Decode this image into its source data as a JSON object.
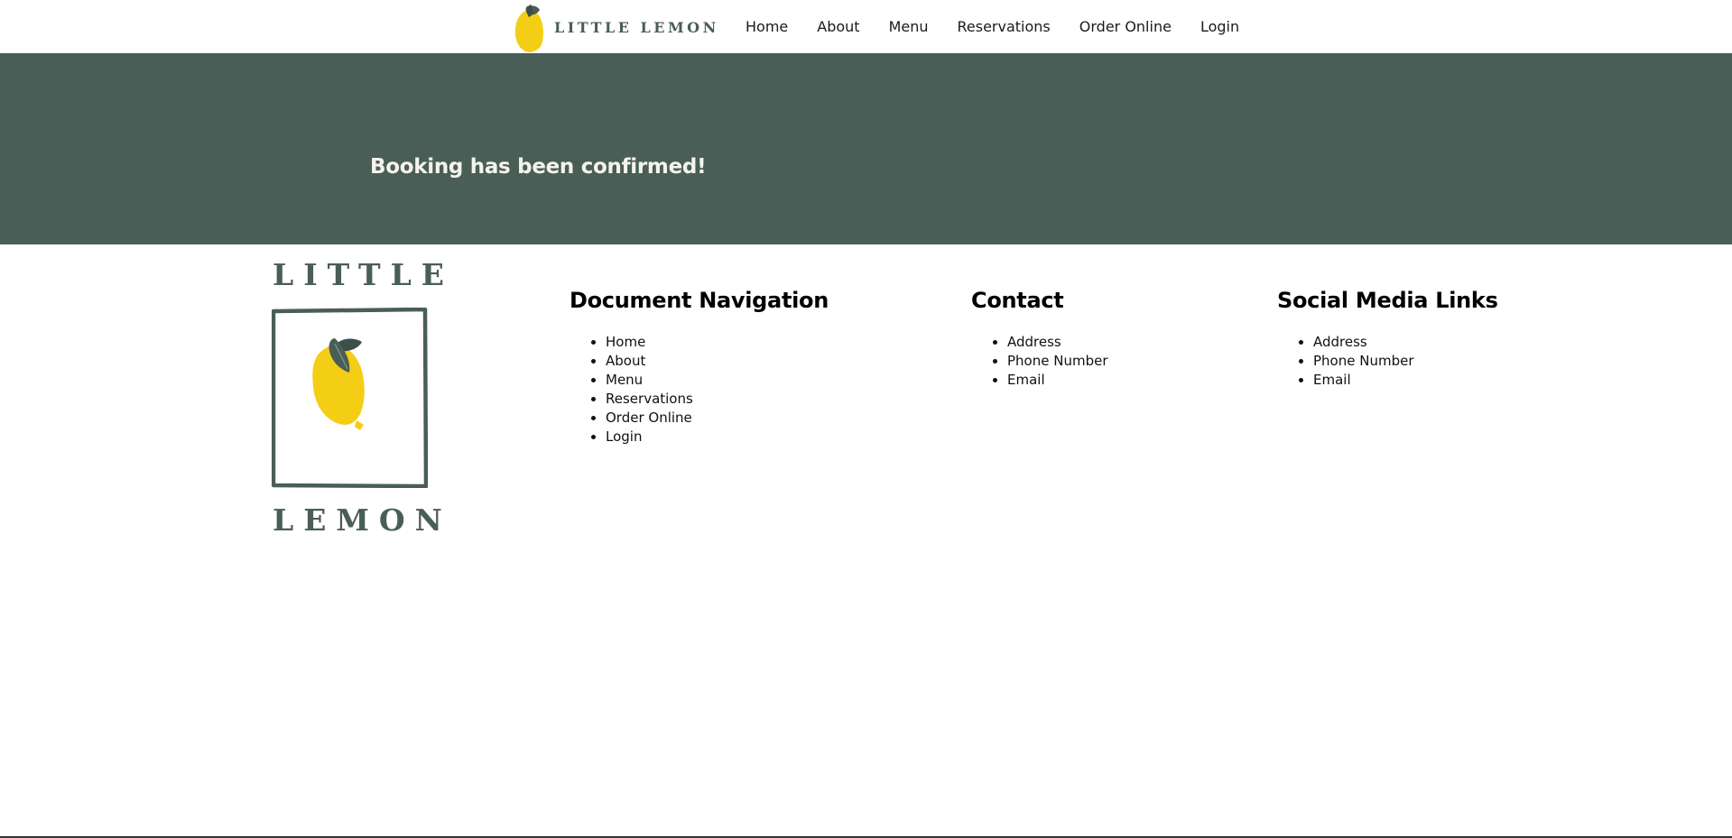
{
  "brand": {
    "name": "LITTLE LEMON"
  },
  "nav": {
    "items": [
      {
        "label": "Home"
      },
      {
        "label": "About"
      },
      {
        "label": "Menu"
      },
      {
        "label": "Reservations"
      },
      {
        "label": "Order Online"
      },
      {
        "label": "Login"
      }
    ]
  },
  "banner": {
    "message": "Booking has been confirmed!"
  },
  "footer": {
    "logo": {
      "top_word": "LITTLE",
      "bottom_word": "LEMON"
    },
    "document_navigation": {
      "heading": "Document Navigation",
      "items": [
        "Home",
        "About",
        "Menu",
        "Reservations",
        "Order Online",
        "Login"
      ]
    },
    "contact": {
      "heading": "Contact",
      "items": [
        "Address",
        "Phone Number",
        "Email"
      ]
    },
    "social_media": {
      "heading": "Social Media Links",
      "items": [
        "Address",
        "Phone Number",
        "Email"
      ]
    }
  },
  "colors": {
    "brand_green": "#495e57",
    "lemon_yellow": "#f4ce14",
    "banner_text": "#f4f4ec"
  },
  "icons": {
    "header_logo": "lemon-icon",
    "footer_logo": "lemon-icon"
  }
}
